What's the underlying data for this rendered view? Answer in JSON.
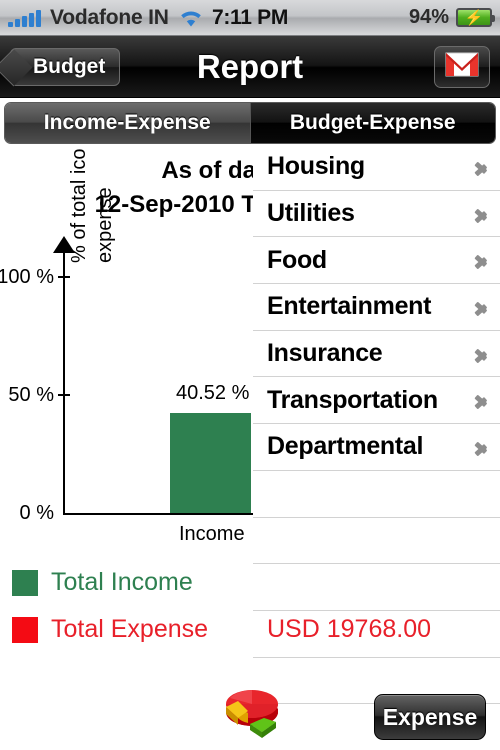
{
  "status_bar": {
    "carrier": "Vodafone IN",
    "time": "7:11 PM",
    "battery_percent": "94%",
    "signal_icon": "signal-bars-icon",
    "wifi_icon": "wifi-icon",
    "battery_icon": "battery-charging-icon"
  },
  "nav_bar": {
    "back_label": "Budget",
    "title": "Report",
    "mail_icon": "gmail-envelope-icon"
  },
  "segmented_control": {
    "segments": [
      {
        "label": "Income-Expense",
        "selected": true
      },
      {
        "label": "Budget-Expense",
        "selected": false
      }
    ]
  },
  "chart_header": {
    "line1": "As of da",
    "line2": "12-Sep-2010 T"
  },
  "chart_data": {
    "type": "bar",
    "title": "",
    "categories": [
      "Income"
    ],
    "values": [
      40.52
    ],
    "value_labels": [
      "40.52 %"
    ],
    "series": [
      {
        "name": "Total Income",
        "values": [
          40.52
        ],
        "color": "#2e8050"
      }
    ],
    "xlabel": "",
    "ylabel": "% of total icome + expense",
    "ylim": [
      0,
      100
    ],
    "yticks": [
      0,
      50,
      100
    ],
    "ytick_labels": [
      "0 %",
      "50 %",
      "100 %"
    ],
    "grid": false,
    "legend_position": "below"
  },
  "category_list": {
    "items": [
      {
        "label": "Housing",
        "chevron": "chevron-right-icon"
      },
      {
        "label": "Utilities",
        "chevron": "chevron-right-icon"
      },
      {
        "label": "Food",
        "chevron": "chevron-right-icon"
      },
      {
        "label": "Entertainment",
        "chevron": "chevron-right-icon"
      },
      {
        "label": "Insurance",
        "chevron": "chevron-right-icon"
      },
      {
        "label": "Transportation",
        "chevron": "chevron-right-icon"
      },
      {
        "label": "Departmental",
        "chevron": "chevron-right-icon"
      },
      {
        "label": "",
        "chevron": ""
      },
      {
        "label": "",
        "chevron": ""
      },
      {
        "label": "",
        "chevron": ""
      },
      {
        "label": "",
        "chevron": ""
      },
      {
        "label": "",
        "chevron": ""
      }
    ]
  },
  "legend": {
    "income": {
      "label": "Total Income",
      "color": "#2e8050",
      "value": ""
    },
    "expense": {
      "label": "Total Expense",
      "color": "#f40b14",
      "value": "USD 19768.00"
    }
  },
  "bottom_bar": {
    "pie_icon": "pie-chart-icon",
    "expense_button_label": "Expense"
  },
  "colors": {
    "income_green": "#2e8050",
    "expense_red": "#f40b14",
    "accent_blue": "#2e7fd0"
  }
}
